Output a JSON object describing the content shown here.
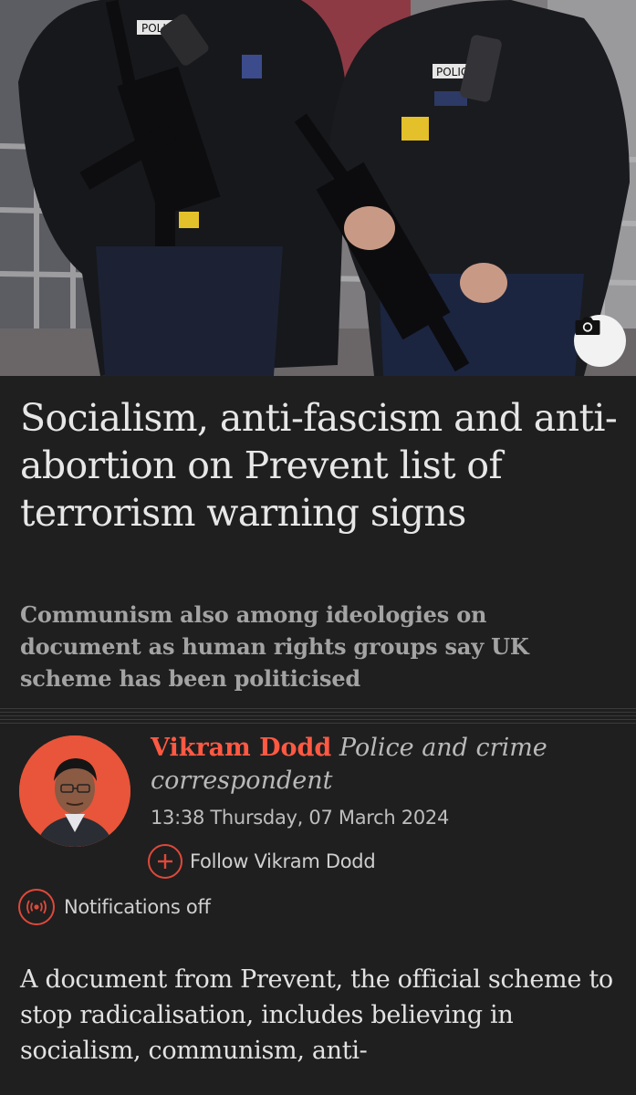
{
  "hero": {
    "camera_icon": "camera-icon",
    "badge_texts": [
      "POLICE",
      "POLICE"
    ]
  },
  "article": {
    "headline": "Socialism, anti-fascism and anti-abortion on Prevent list of terrorism warning signs",
    "standfirst": "Communism also among ideologies on document as human rights groups say UK scheme has been politicised",
    "author_name": "Vikram Dodd",
    "author_role": "Police and crime correspondent",
    "timestamp": "13:38 Thursday, 07 March 2024",
    "follow_label": "Follow Vikram Dodd",
    "notifications_label": "Notifications off",
    "body": "A document from Prevent, the official scheme to stop radicalisation, includes believing in socialism, communism, anti-"
  },
  "colors": {
    "accent": "#ff5943",
    "background": "#1f1f1f",
    "headline": "#e7e7e7",
    "standfirst": "#a3a3a3"
  }
}
